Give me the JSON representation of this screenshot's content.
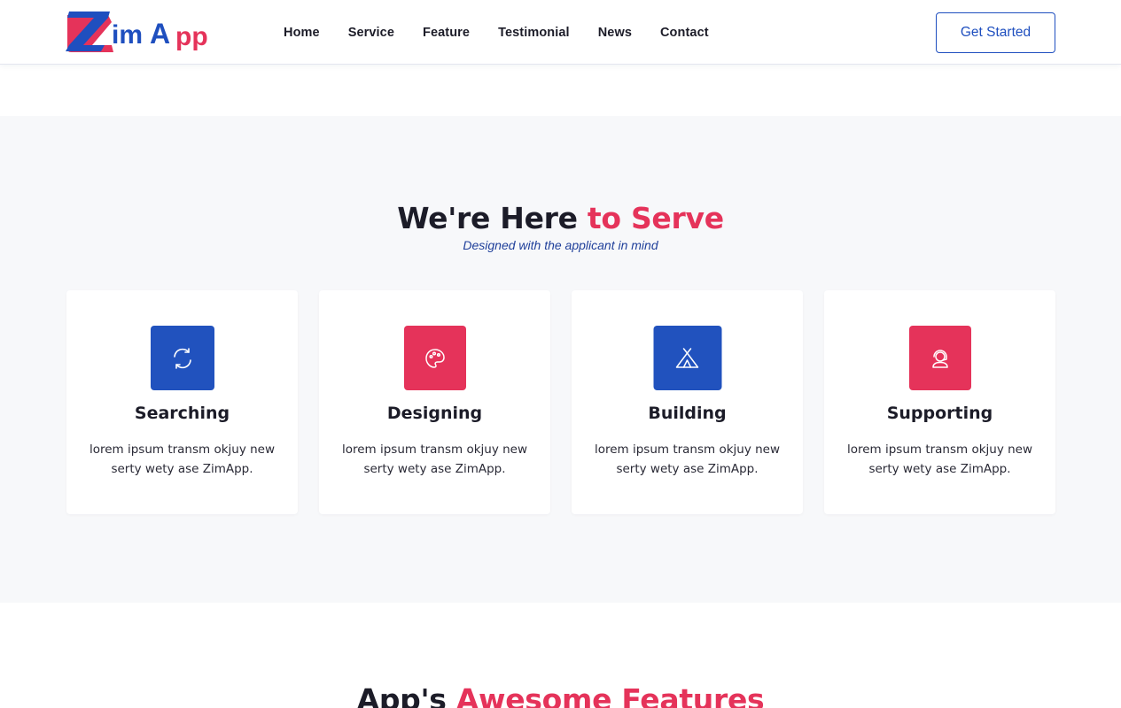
{
  "brand": {
    "logo_text": "ZimApp",
    "blue": "#1f4fbf",
    "red": "#e5335a"
  },
  "nav": {
    "items": [
      {
        "label": "Home"
      },
      {
        "label": "Service"
      },
      {
        "label": "Feature"
      },
      {
        "label": "Testimonial"
      },
      {
        "label": "News"
      },
      {
        "label": "Contact"
      }
    ],
    "cta_label": "Get Started"
  },
  "service": {
    "title_main": "We're Here ",
    "title_accent": "to Serve",
    "subtitle": "Designed with the applicant in mind",
    "cards": [
      {
        "icon": "refresh-icon",
        "title": "Searching",
        "text": "lorem ipsum transm okjuy new serty wety ase ZimApp."
      },
      {
        "icon": "palette-icon",
        "title": "Designing",
        "text": "lorem ipsum transm okjuy new serty wety ase ZimApp."
      },
      {
        "icon": "tent-icon",
        "title": "Building",
        "text": "lorem ipsum transm okjuy new serty wety ase ZimApp."
      },
      {
        "icon": "support-agent-icon",
        "title": "Supporting",
        "text": "lorem ipsum transm okjuy new serty wety ase ZimApp."
      }
    ]
  },
  "features": {
    "title_main": "App's ",
    "title_accent": "Awesome Features"
  }
}
